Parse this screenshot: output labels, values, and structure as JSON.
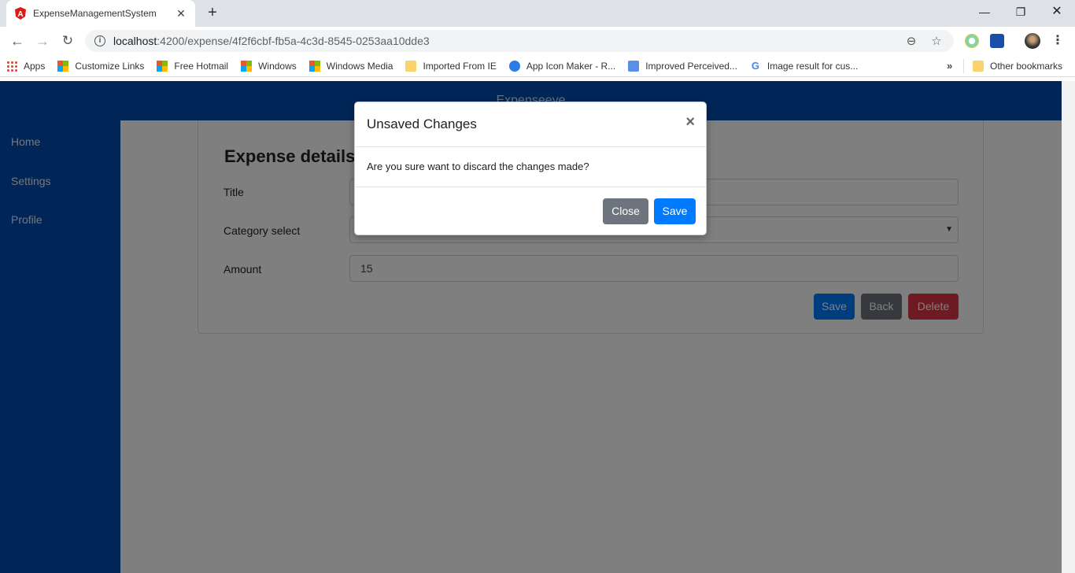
{
  "browser": {
    "tab_title": "ExpenseManagementSystem",
    "url_host": "localhost",
    "url_path": ":4200/expense/4f2f6cbf-fb5a-4c3d-8545-0253aa10dde3",
    "bookmarks": [
      {
        "label": "Apps",
        "icon": "apps-icon"
      },
      {
        "label": "Customize Links",
        "icon": "windows-icon"
      },
      {
        "label": "Free Hotmail",
        "icon": "windows-icon"
      },
      {
        "label": "Windows",
        "icon": "windows-icon"
      },
      {
        "label": "Windows Media",
        "icon": "windows-icon"
      },
      {
        "label": "Imported From IE",
        "icon": "folder-icon"
      },
      {
        "label": "App Icon Maker - R...",
        "icon": "app-icon-maker-icon"
      },
      {
        "label": "Improved Perceived...",
        "icon": "doc-icon"
      },
      {
        "label": "Image result for cus...",
        "icon": "google-icon"
      }
    ],
    "other_bookmarks": "Other bookmarks"
  },
  "app": {
    "header_title": "Expenseeye",
    "sidebar": [
      "Home",
      "Settings",
      "Profile"
    ]
  },
  "form": {
    "title": "Expense details",
    "title_label": "Title",
    "title_value": "",
    "category_label": "Category select",
    "category_value": "",
    "amount_label": "Amount",
    "amount_value": "15",
    "save_label": "Save",
    "back_label": "Back",
    "delete_label": "Delete"
  },
  "modal": {
    "title": "Unsaved Changes",
    "close_glyph": "×",
    "body": "Are you sure want to discard the changes made?",
    "close_label": "Close",
    "save_label": "Save"
  },
  "colors": {
    "brand": "#004aad",
    "primary": "#007bff",
    "secondary": "#6c757d",
    "danger": "#dc3545"
  }
}
